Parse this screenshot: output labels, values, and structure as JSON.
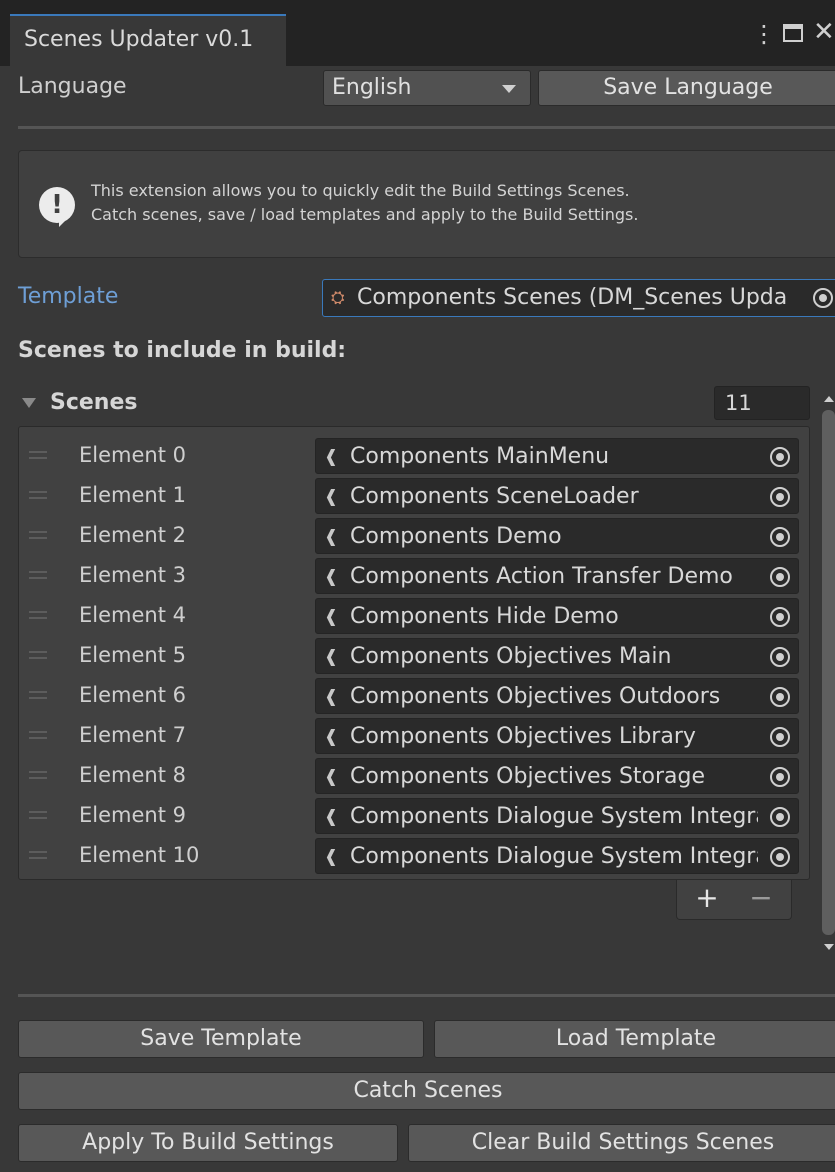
{
  "window": {
    "tab_title": "Scenes Updater v0.1",
    "menu_icon": "kebab-menu-icon",
    "maximize_icon": "maximize-icon",
    "close_icon": "close-icon"
  },
  "language": {
    "label": "Language",
    "selected": "English",
    "save_label": "Save Language"
  },
  "help": {
    "icon": "warning-icon",
    "line1": "This extension allows you to quickly edit the Build Settings Scenes.",
    "line2": "Catch scenes, save / load templates and apply to the Build Settings."
  },
  "template": {
    "label": "Template",
    "value": "Components Scenes (DM_Scenes Upda"
  },
  "scenes_header": "Scenes to include in build:",
  "scenes": {
    "foldout_label": "Scenes",
    "count": "11",
    "items": [
      {
        "label": "Element 0",
        "value": "Components MainMenu"
      },
      {
        "label": "Element 1",
        "value": "Components SceneLoader"
      },
      {
        "label": "Element 2",
        "value": "Components Demo"
      },
      {
        "label": "Element 3",
        "value": "Components Action Transfer Demo"
      },
      {
        "label": "Element 4",
        "value": "Components Hide Demo"
      },
      {
        "label": "Element 5",
        "value": "Components Objectives Main"
      },
      {
        "label": "Element 6",
        "value": "Components Objectives Outdoors"
      },
      {
        "label": "Element 7",
        "value": "Components Objectives Library"
      },
      {
        "label": "Element 8",
        "value": "Components Objectives Storage"
      },
      {
        "label": "Element 9",
        "value": "Components Dialogue System Integra"
      },
      {
        "label": "Element 10",
        "value": "Components Dialogue System Integra"
      }
    ],
    "add_label": "+",
    "remove_label": "−"
  },
  "buttons": {
    "save_template": "Save Template",
    "load_template": "Load Template",
    "catch_scenes": "Catch Scenes",
    "apply_build": "Apply To Build Settings",
    "clear_build": "Clear Build Settings Scenes"
  },
  "colors": {
    "accent": "#3a79bb",
    "background": "#383838",
    "titlebar": "#232323"
  }
}
